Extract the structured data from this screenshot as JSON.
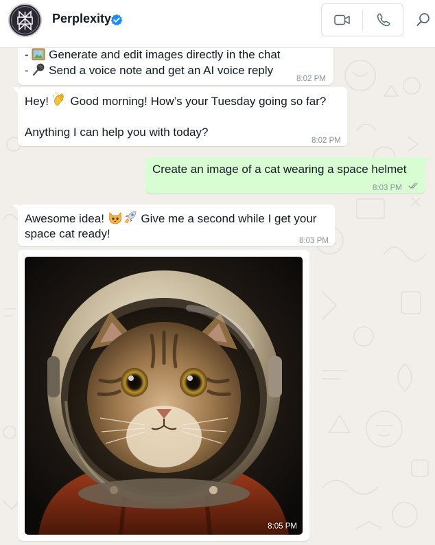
{
  "header": {
    "contact_name": "Perplexity",
    "avatar": "perplexity-logo",
    "verified_icon": "verified-badge-icon",
    "video_call_icon": "video-camera-icon",
    "voice_call_icon": "phone-icon",
    "search_icon": "search-icon"
  },
  "messages": [
    {
      "direction": "in",
      "lines": [
        "- 🖼️ Generate and edit images directly in the chat",
        "- 🎤 Send a voice note and get an AI voice reply"
      ],
      "line1_icon": "framed-picture-emoji",
      "line1_text": "Generate and edit images directly in the chat",
      "line2_icon": "microphone-emoji",
      "line2_text": "Send a voice note and get an AI voice reply",
      "bullet": "-",
      "time": "8:02 PM"
    },
    {
      "direction": "in",
      "text_line1_pre": "Hey! ",
      "text_line1_emoji": "waving-hand-emoji",
      "text_line1_post": " Good morning! How’s your Tuesday going so far?",
      "text_line2": "Anything I can help you with today?",
      "time": "8:02 PM"
    },
    {
      "direction": "out",
      "text": "Create an image of a cat wearing a space helmet",
      "time": "8:03 PM",
      "status": "read"
    },
    {
      "direction": "in",
      "text_line1_pre": "Awesome idea! ",
      "text_line1_emojis": [
        "cat-face-emoji",
        "rocket-emoji"
      ],
      "text_line1_post": " Give me a second while I get your",
      "text_line2": "space cat ready!",
      "time": "8:03 PM"
    },
    {
      "direction": "in",
      "type": "image",
      "image_subject": "tabby-cat-in-astronaut-helmet",
      "time": "8:05 PM"
    }
  ],
  "colors": {
    "chat_background": "#f2efea",
    "incoming_bubble": "#ffffff",
    "outgoing_bubble": "#d9fdd3",
    "verified_blue": "#1d8bf1",
    "timestamp": "#8a9196"
  }
}
